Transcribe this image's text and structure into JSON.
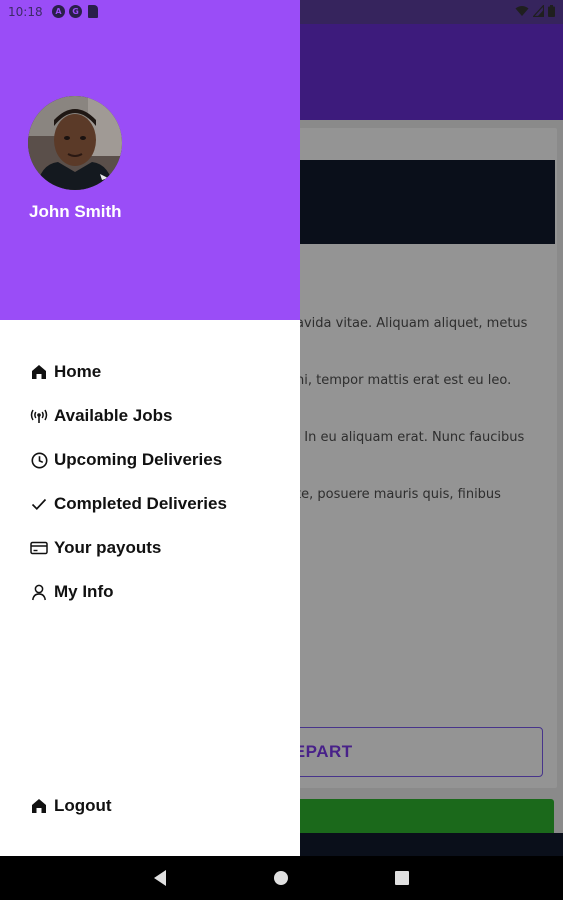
{
  "status_bar": {
    "time": "10:18",
    "left_icons": [
      "a11y-icon",
      "gallery-app-icon",
      "sd-card-icon"
    ],
    "right_icons": [
      "wifi-icon",
      "signal-icon",
      "battery-icon"
    ]
  },
  "drawer": {
    "user_name": "John Smith",
    "header_color": "#9a4df7",
    "nav_items": [
      {
        "label": "Home",
        "icon": "home-icon"
      },
      {
        "label": "Available Jobs",
        "icon": "broadcast-icon"
      },
      {
        "label": "Upcoming Deliveries",
        "icon": "clock-icon"
      },
      {
        "label": "Completed Deliveries",
        "icon": "check-icon"
      },
      {
        "label": "Your payouts",
        "icon": "credit-card-icon"
      },
      {
        "label": "My Info",
        "icon": "person-icon"
      }
    ],
    "logout": {
      "label": "Logout",
      "icon": "home-icon"
    }
  },
  "background_app": {
    "body_lines": [
      "avida vitae. Aliquam aliquet, metus",
      "ni, tempor mattis erat est eu leo.",
      ". In eu aliquam erat. Nunc faucibus",
      "te, posuere mauris quis, finibus"
    ],
    "depart_button_label": "DEPART",
    "accent_color": "#7c3aed",
    "green_bar_color": "#2fb52f"
  },
  "system_nav": {
    "buttons": [
      "back-icon",
      "home-circle-icon",
      "recents-icon"
    ]
  }
}
